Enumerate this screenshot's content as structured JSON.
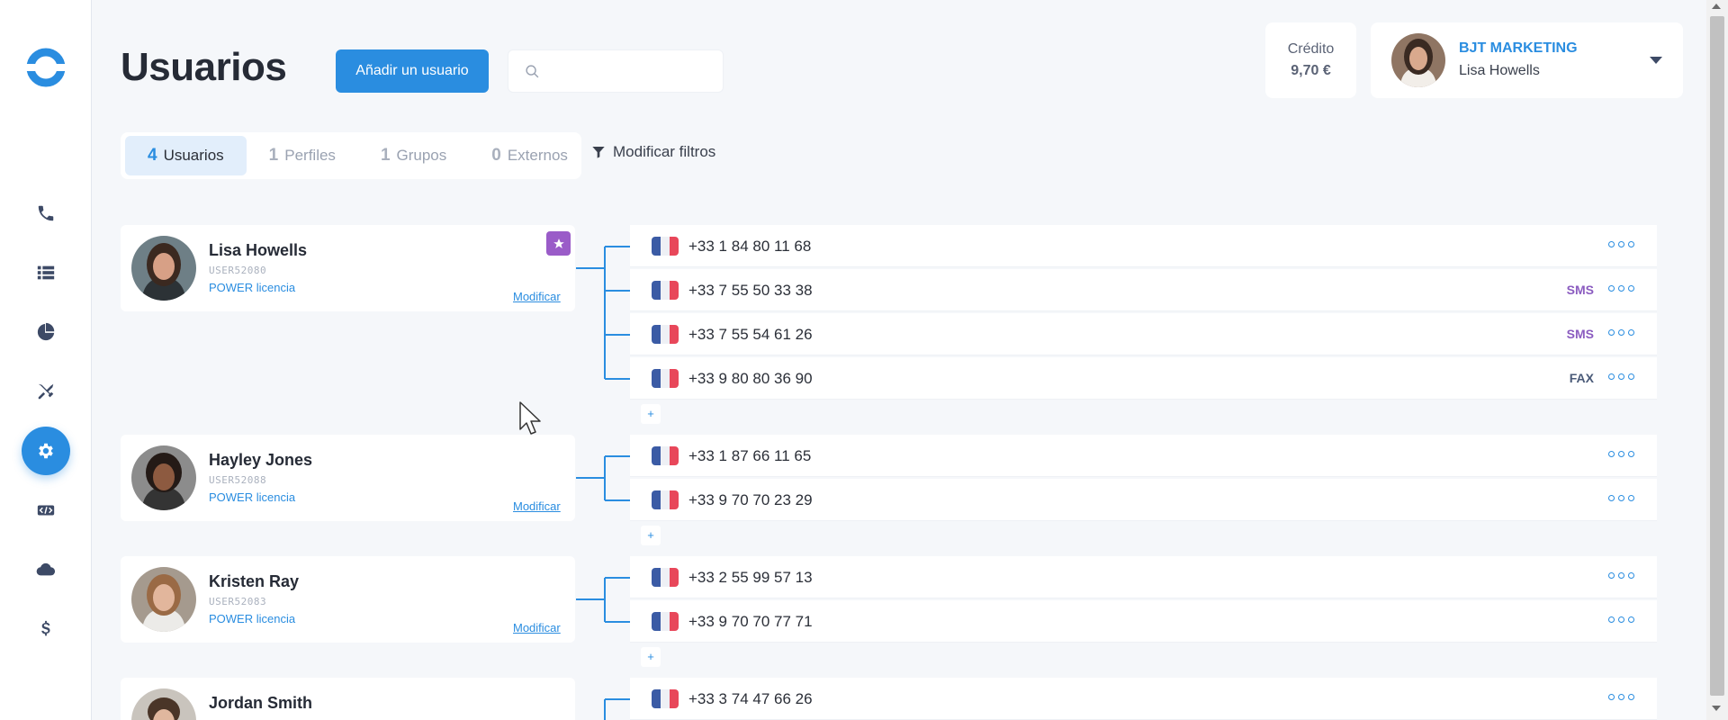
{
  "sidebar": {
    "logo": "app-logo-icon",
    "items": [
      {
        "name": "calls",
        "icon": "phone-icon"
      },
      {
        "name": "list",
        "icon": "list-icon"
      },
      {
        "name": "stats",
        "icon": "pie-chart-icon"
      },
      {
        "name": "tools",
        "icon": "crossed-tools-icon"
      },
      {
        "name": "settings",
        "icon": "gear-icon",
        "active": true
      },
      {
        "name": "developer",
        "icon": "code-icon"
      },
      {
        "name": "cloud",
        "icon": "cloud-icon"
      },
      {
        "name": "billing",
        "icon": "dollar-icon"
      }
    ]
  },
  "header": {
    "title": "Usuarios",
    "add_button": "Añadir un usuario",
    "search_placeholder": ""
  },
  "credit": {
    "label": "Crédito",
    "value": "9,70 €"
  },
  "account": {
    "company": "BJT MARKETING",
    "user": "Lisa Howells"
  },
  "tabs": [
    {
      "count": "4",
      "label": "Usuarios",
      "active": true
    },
    {
      "count": "1",
      "label": "Perfiles"
    },
    {
      "count": "1",
      "label": "Grupos"
    },
    {
      "count": "0",
      "label": "Externos"
    }
  ],
  "filter_label": "Modificar filtros",
  "modify_label": "Modificar",
  "users": [
    {
      "name": "Lisa Howells",
      "id": "USER52080",
      "license": "POWER licencia",
      "starred": true,
      "numbers": [
        {
          "number": "+33 1 84 80 11 68",
          "tag": ""
        },
        {
          "number": "+33 7 55 50 33 38",
          "tag": "SMS"
        },
        {
          "number": "+33 7 55 54 61 26",
          "tag": "SMS"
        },
        {
          "number": "+33 9 80 80 36 90",
          "tag": "FAX"
        }
      ]
    },
    {
      "name": "Hayley Jones",
      "id": "USER52088",
      "license": "POWER licencia",
      "numbers": [
        {
          "number": "+33 1 87 66 11 65",
          "tag": ""
        },
        {
          "number": "+33 9 70 70 23 29",
          "tag": ""
        }
      ]
    },
    {
      "name": "Kristen Ray",
      "id": "USER52083",
      "license": "POWER licencia",
      "numbers": [
        {
          "number": "+33 2 55 99 57 13",
          "tag": ""
        },
        {
          "number": "+33 9 70 70 77 71",
          "tag": ""
        }
      ]
    },
    {
      "name": "Jordan Smith",
      "numbers": [
        {
          "number": "+33 3 74 47 66 26",
          "tag": ""
        }
      ]
    }
  ],
  "add_number_label": "+",
  "colors": {
    "accent": "#2a8de0",
    "sms": "#8b5cc0",
    "fax": "#4a5a78",
    "star": "#9a5cc8"
  }
}
